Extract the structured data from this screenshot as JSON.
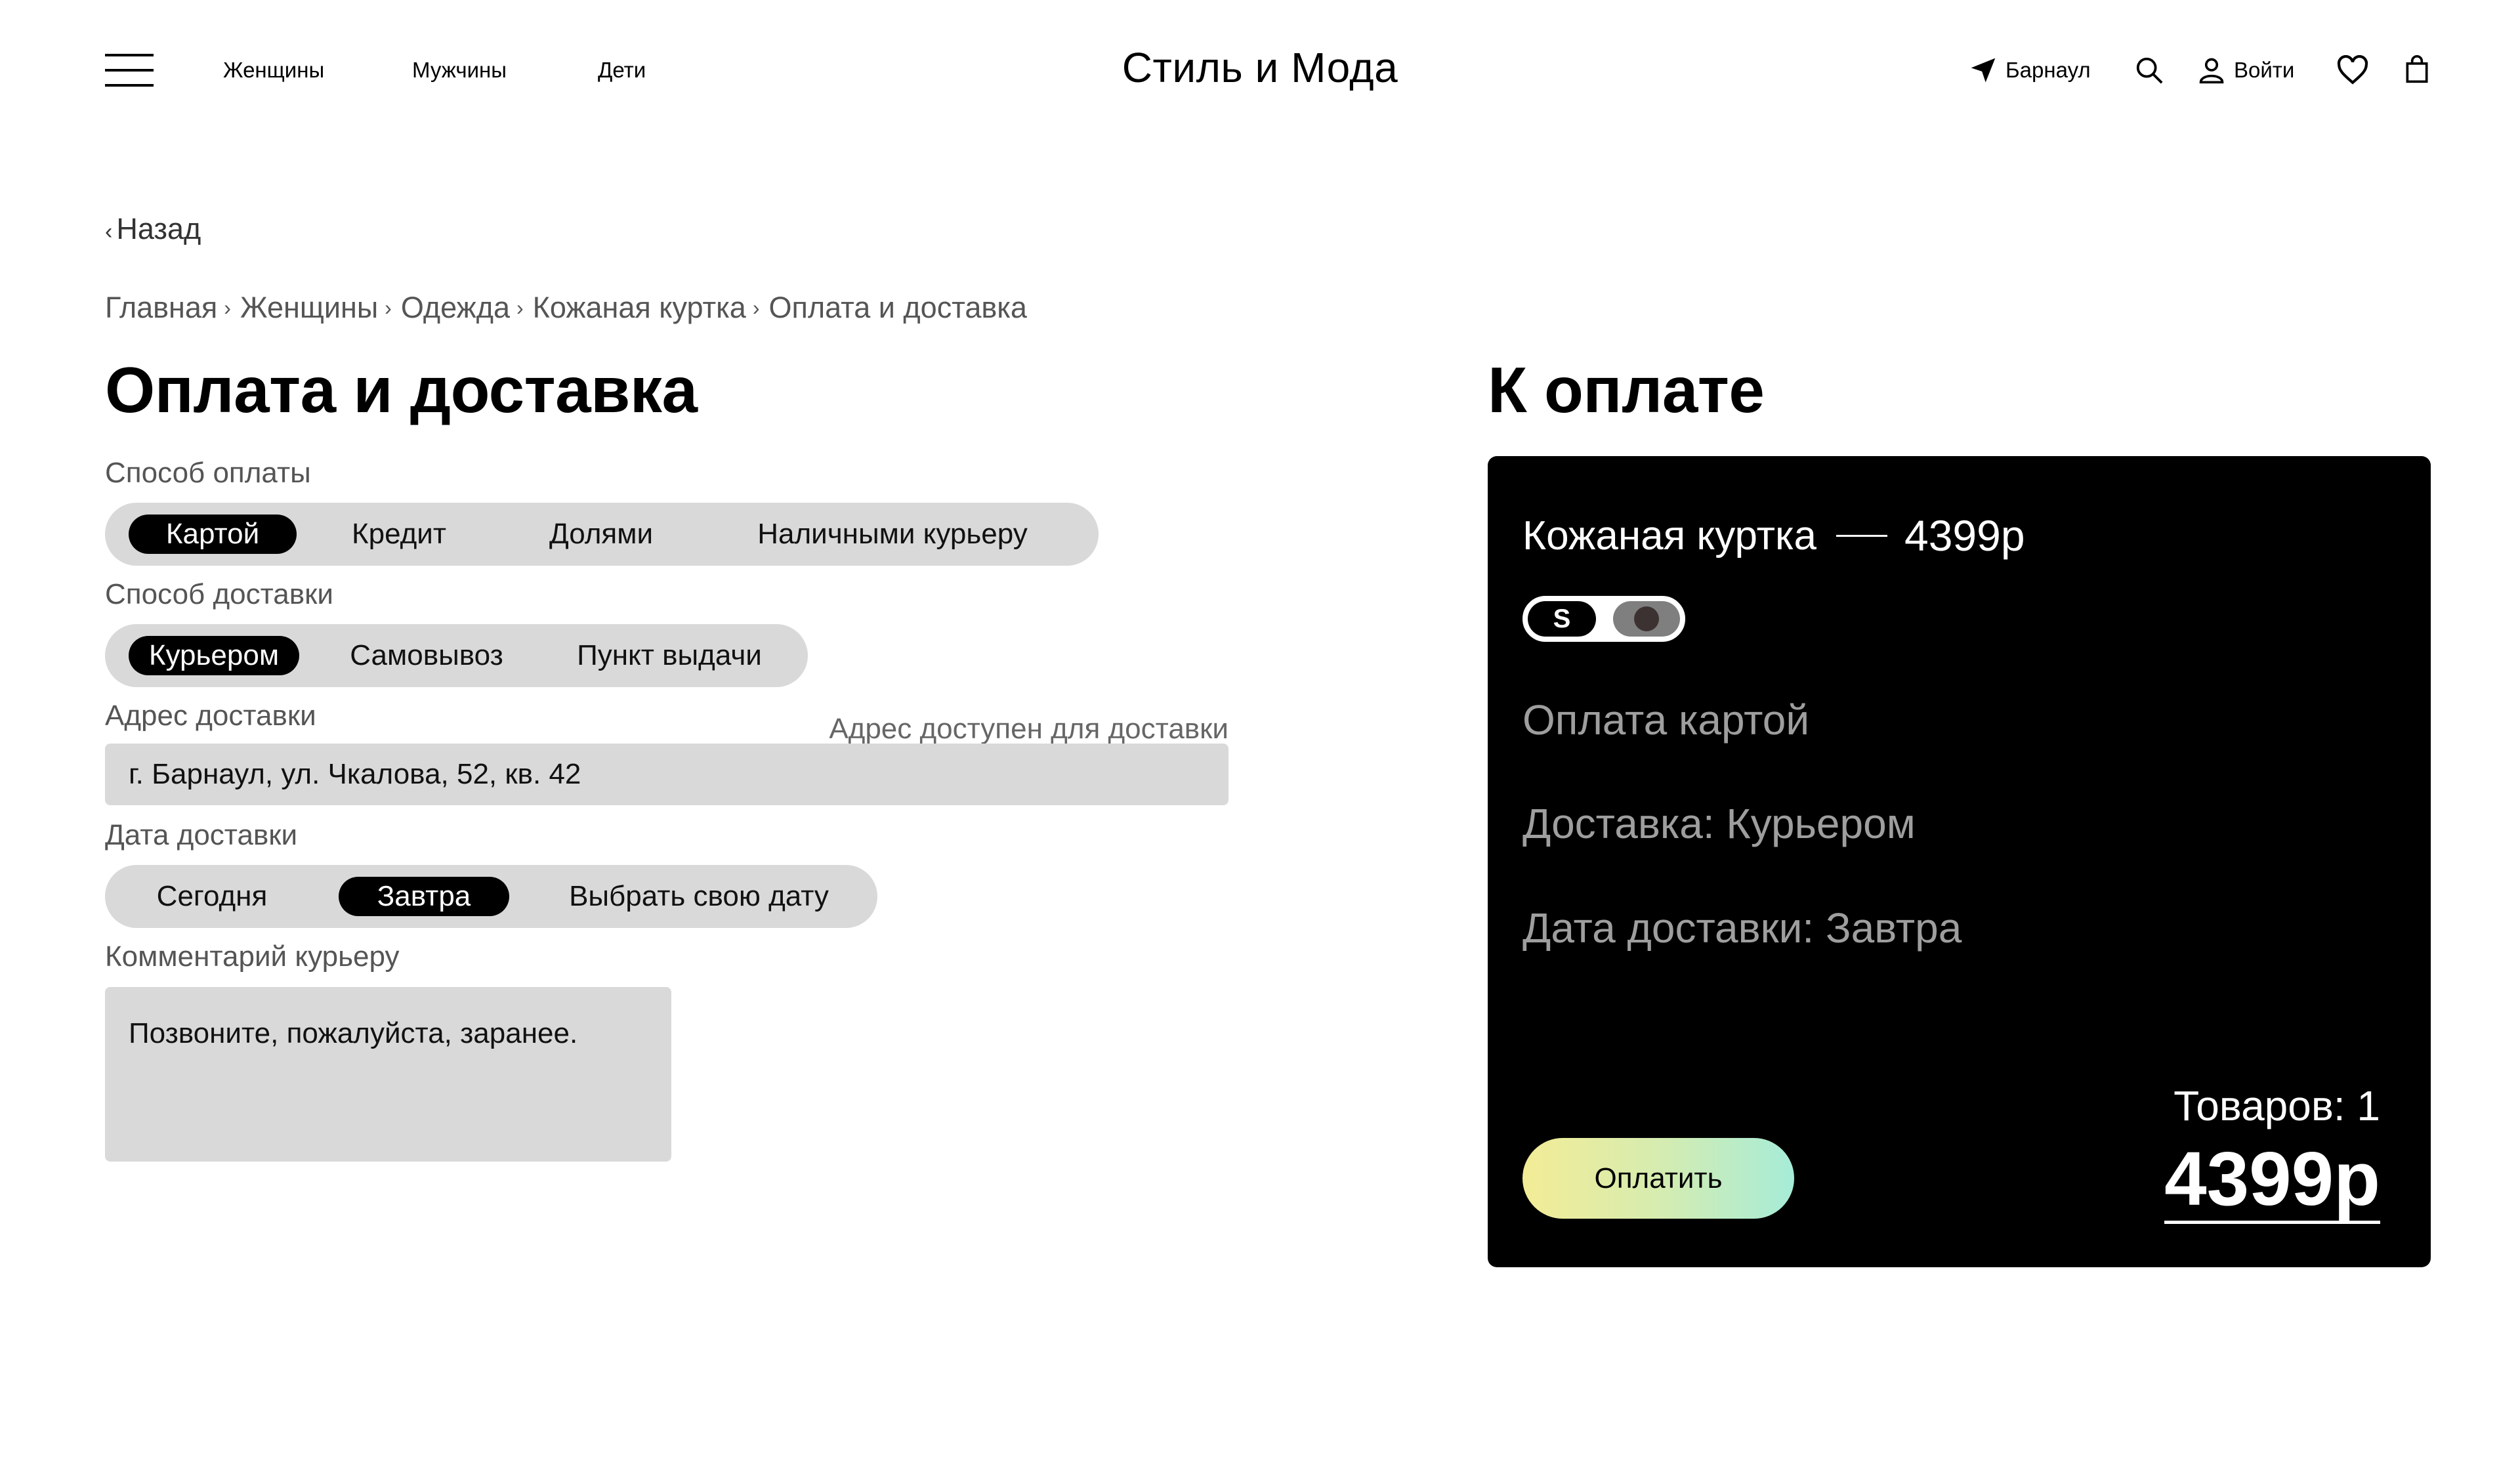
{
  "header": {
    "nav": [
      "Женщины",
      "Мужчины",
      "Дети"
    ],
    "logo": "Стиль и Мода",
    "city": "Барнаул",
    "login": "Войти"
  },
  "back_label": "Назад",
  "breadcrumb": [
    "Главная",
    "Женщины",
    "Одежда",
    "Кожаная куртка",
    "Оплата и доставка"
  ],
  "form": {
    "title": "Оплата и доставка",
    "payment": {
      "label": "Способ оплаты",
      "options": [
        "Картой",
        "Кредит",
        "Долями",
        "Наличными курьеру"
      ],
      "selected": "Картой"
    },
    "delivery": {
      "label": "Способ доставки",
      "options": [
        "Курьером",
        "Самовывоз",
        "Пункт выдачи"
      ],
      "selected": "Курьером"
    },
    "address": {
      "label": "Адрес доставки",
      "hint": "Адрес доступен для доставки",
      "value": "г. Барнаул, ул. Чкалова, 52, кв. 42"
    },
    "date": {
      "label": "Дата доставки",
      "options": [
        "Сегодня",
        "Завтра",
        "Выбрать свою дату"
      ],
      "selected": "Завтра"
    },
    "comment": {
      "label": "Комментарий курьеру",
      "value": "Позвоните, пожалуйста, заранее."
    }
  },
  "summary": {
    "title": "К оплате",
    "product_name": "Кожаная куртка",
    "product_price": "4399р",
    "size": "S",
    "color_hex": "#3d3232",
    "payment_line": "Оплата картой",
    "delivery_line": "Доставка: Курьером",
    "date_line": "Дата доставки: Завтра",
    "count": "Товаров: 1",
    "total": "4399р",
    "pay_button": "Оплатить",
    "pay_gradient": [
      "#f3ec96",
      "#a6ecd8"
    ]
  }
}
